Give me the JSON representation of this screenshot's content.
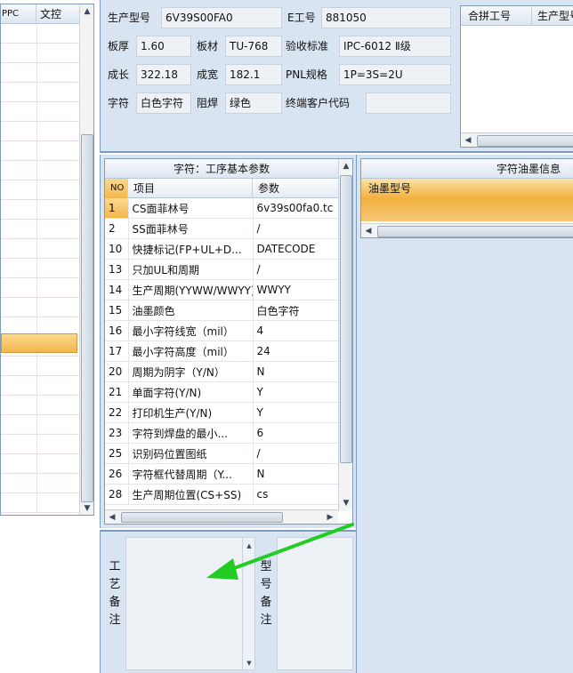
{
  "left_grid": {
    "col1": "PPC",
    "col2": "文控"
  },
  "info": {
    "production_model_label": "生产型号",
    "production_model_value": "6V39S00FA0",
    "e_number_label": "E工号",
    "e_number_value": "881050",
    "thickness_label": "板厚",
    "thickness_value": "1.60",
    "material_label": "板材",
    "material_value": "TU-768",
    "acceptance_label": "验收标准",
    "acceptance_value": "IPC-6012 Ⅱ级",
    "length_label": "成长",
    "length_value": "322.18",
    "width_label": "成宽",
    "width_value": "182.1",
    "pnl_label": "PNL规格",
    "pnl_value": "1P=3S=2U",
    "char_label": "字符",
    "char_value": "白色字符",
    "mask_label": "阻焊",
    "mask_value": "绿色",
    "end_customer_label": "终端客户代码",
    "end_customer_value": ""
  },
  "merge_grid": {
    "col1": "合拼工号",
    "col2": "生产型号"
  },
  "params": {
    "title": "字符：工序基本参数",
    "col_no": "NO",
    "col_item": "项目",
    "col_param": "参数",
    "rows": [
      {
        "no": "1",
        "item": "CS面菲林号",
        "param": "6v39s00fa0.tc"
      },
      {
        "no": "2",
        "item": "SS面菲林号",
        "param": "/"
      },
      {
        "no": "10",
        "item": "快捷标记(FP+UL+D...",
        "param": "DATECODE"
      },
      {
        "no": "13",
        "item": "只加UL和周期",
        "param": "/"
      },
      {
        "no": "14",
        "item": "生产周期(YYWW/WWYY)",
        "param": "WWYY"
      },
      {
        "no": "15",
        "item": "油墨颜色",
        "param": "白色字符"
      },
      {
        "no": "16",
        "item": "最小字符线宽（mil）",
        "param": "4"
      },
      {
        "no": "17",
        "item": "最小字符高度（mil）",
        "param": "24"
      },
      {
        "no": "20",
        "item": "周期为阴字（Y/N）",
        "param": "N"
      },
      {
        "no": "21",
        "item": "单面字符(Y/N)",
        "param": "Y"
      },
      {
        "no": "22",
        "item": "打印机生产(Y/N)",
        "param": "Y"
      },
      {
        "no": "23",
        "item": "字符到焊盘的最小...",
        "param": "6"
      },
      {
        "no": "25",
        "item": "识别码位置图纸",
        "param": "/"
      },
      {
        "no": "26",
        "item": "字符框代替周期（Y...",
        "param": "N"
      },
      {
        "no": "28",
        "item": "生产周期位置(CS+SS)",
        "param": "cs"
      }
    ]
  },
  "ink": {
    "title": "字符油墨信息",
    "col_model": "油墨型号"
  },
  "remarks": {
    "process_label": "工艺备注",
    "model_label": "型号备注"
  },
  "colors": {
    "pane": "#d9e4f2",
    "selected_row": "#f6c66e",
    "arrow": "#22cc22"
  }
}
